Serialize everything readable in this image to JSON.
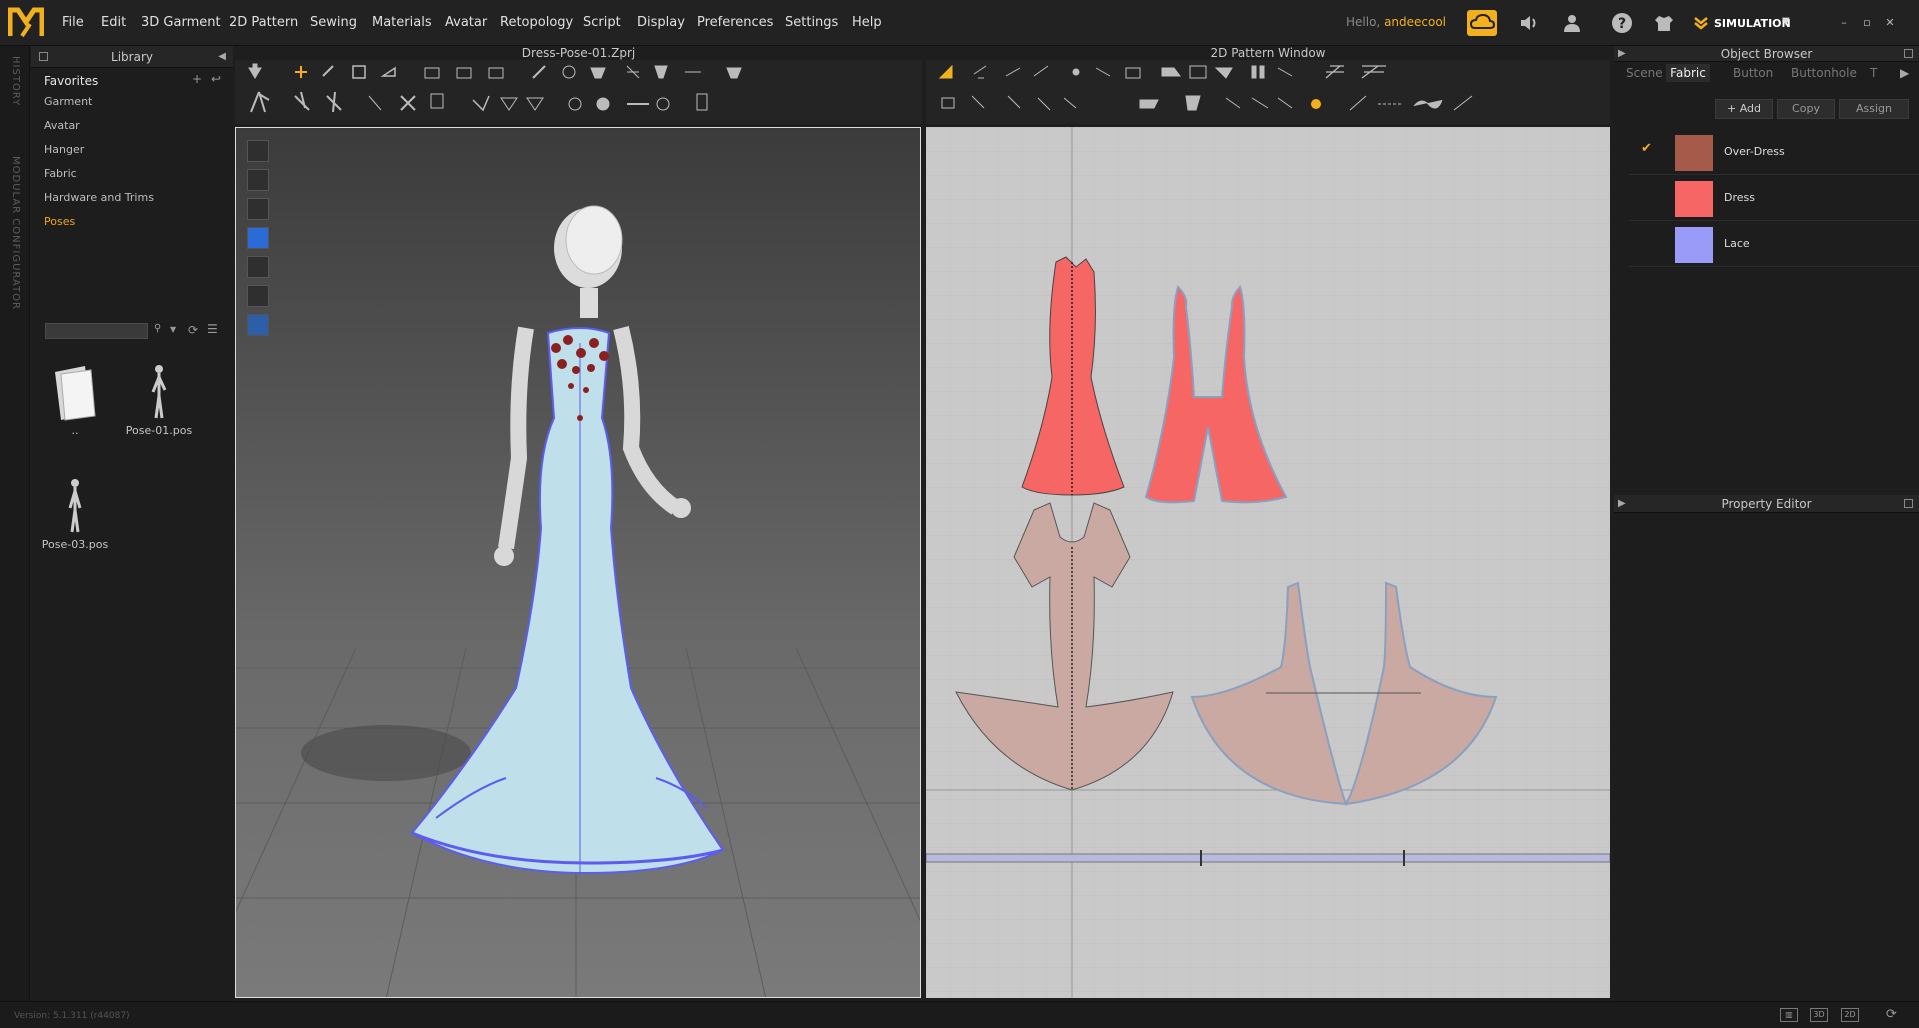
{
  "menu": [
    "File",
    "Edit",
    "3D Garment",
    "2D Pattern",
    "Sewing",
    "Materials",
    "Avatar",
    "Retopology",
    "Script",
    "Display",
    "Preferences",
    "Settings",
    "Help"
  ],
  "user": {
    "greeting": "Hello,",
    "name": "andeecool"
  },
  "simulation": {
    "label": "SIMULATION"
  },
  "side_tabs": [
    "HISTORY",
    "MODULAR CONFIGURATOR"
  ],
  "library": {
    "title": "Library",
    "favorites": "Favorites",
    "items": [
      "Garment",
      "Avatar",
      "Hanger",
      "Fabric",
      "Hardware and Trims",
      "Poses"
    ],
    "selected": "Poses",
    "search_value": "",
    "files": [
      {
        "name": "..",
        "icon": "folder-icon"
      },
      {
        "name": "Pose-01.pos",
        "icon": "pose-figure-icon"
      },
      {
        "name": "Pose-03.pos",
        "icon": "pose-figure-icon"
      }
    ]
  },
  "view3d": {
    "title": "Dress-Pose-01.Zprj"
  },
  "view2d": {
    "title": "2D Pattern Window"
  },
  "object_browser": {
    "title": "Object Browser",
    "tabs": [
      "Scene",
      "Fabric",
      "Button",
      "Buttonhole",
      "T"
    ],
    "active_tab": "Fabric",
    "buttons": [
      "+ Add",
      "Copy",
      "Assign"
    ],
    "fabrics": [
      {
        "name": "Over-Dress",
        "color": "#a55a4a",
        "checked": true
      },
      {
        "name": "Dress",
        "color": "#f66665",
        "checked": false
      },
      {
        "name": "Lace",
        "color": "#9a9af8",
        "checked": false
      }
    ]
  },
  "property_editor": {
    "title": "Property Editor"
  },
  "status": {
    "version": "Version: 5.1.311 (r44087)",
    "view_modes": [
      "3D",
      "2D"
    ]
  },
  "colors": {
    "accent": "#f2b01e",
    "selected": "#f2a41b"
  }
}
